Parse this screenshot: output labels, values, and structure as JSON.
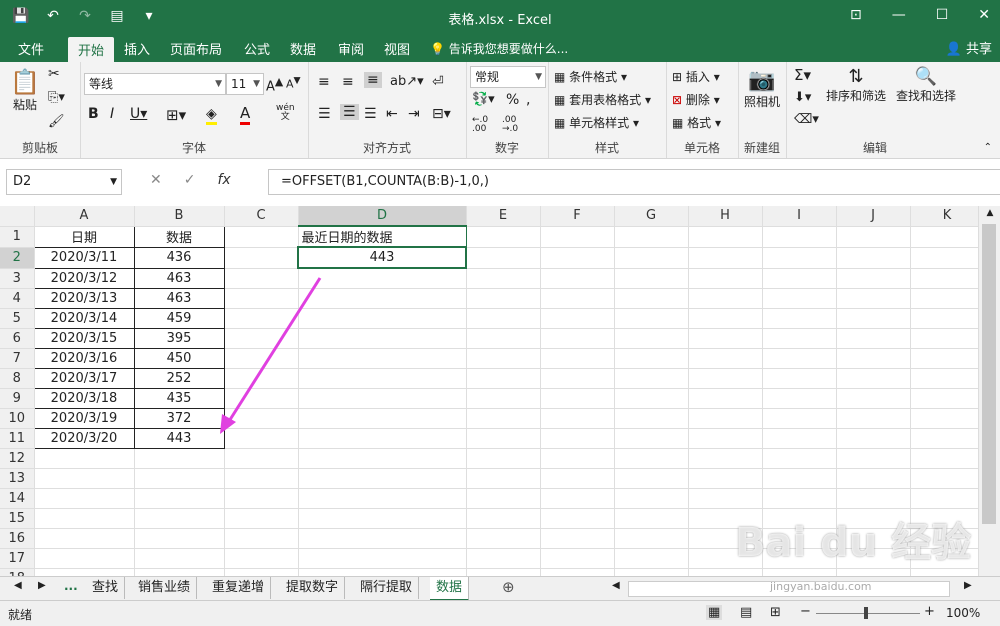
{
  "window": {
    "title": "表格.xlsx - Excel"
  },
  "qat": {
    "save": "💾",
    "undo": "↶",
    "redo": "↷",
    "form": "▤",
    "more": "▾"
  },
  "winctl": {
    "ribbon_opts": "⊡",
    "minimize": "—",
    "maximize": "☐",
    "close": "✕"
  },
  "menu": {
    "tabs": [
      "文件",
      "开始",
      "插入",
      "页面布局",
      "公式",
      "数据",
      "审阅",
      "视图"
    ],
    "tell_me": "告诉我您想要做什么...",
    "share": "共享"
  },
  "ribbon": {
    "clipboard": {
      "paste": "粘贴",
      "group": "剪贴板"
    },
    "font": {
      "font_name": "等线",
      "font_size": "11",
      "group": "字体",
      "wen": "wén"
    },
    "alignment": {
      "group": "对齐方式"
    },
    "number": {
      "format": "常规",
      "group": "数字"
    },
    "styles": {
      "conditional": "条件格式",
      "table": "套用表格格式",
      "cell": "单元格样式",
      "group": "样式"
    },
    "cells": {
      "insert": "插入",
      "delete": "删除",
      "format": "格式",
      "group": "单元格"
    },
    "camera": {
      "label": "照相机",
      "group": "新建组"
    },
    "editing": {
      "sort": "排序和筛选",
      "find": "查找和选择",
      "group": "编辑"
    }
  },
  "formula_bar": {
    "name_box": "D2",
    "cancel": "✕",
    "enter": "✓",
    "fx": "fx",
    "formula": "=OFFSET(B1,COUNTA(B:B)-1,0,)"
  },
  "sheet": {
    "columns": [
      "A",
      "B",
      "C",
      "D",
      "E",
      "F",
      "G",
      "H",
      "I",
      "J",
      "K"
    ],
    "rows": [
      [
        "日期",
        "数据",
        "",
        "最近日期的数据"
      ],
      [
        "2020/3/11",
        "436",
        "",
        "443"
      ],
      [
        "2020/3/12",
        "463",
        "",
        ""
      ],
      [
        "2020/3/13",
        "463",
        "",
        ""
      ],
      [
        "2020/3/14",
        "459",
        "",
        ""
      ],
      [
        "2020/3/15",
        "395",
        "",
        ""
      ],
      [
        "2020/3/16",
        "450",
        "",
        ""
      ],
      [
        "2020/3/17",
        "252",
        "",
        ""
      ],
      [
        "2020/3/18",
        "435",
        "",
        ""
      ],
      [
        "2020/3/19",
        "372",
        "",
        ""
      ],
      [
        "2020/3/20",
        "443",
        "",
        ""
      ],
      [
        "",
        "",
        "",
        ""
      ],
      [
        "",
        "",
        "",
        ""
      ],
      [
        "",
        "",
        "",
        ""
      ],
      [
        "",
        "",
        "",
        ""
      ],
      [
        "",
        "",
        "",
        ""
      ],
      [
        "",
        "",
        "",
        ""
      ],
      [
        "",
        "",
        "",
        ""
      ]
    ]
  },
  "sheet_tabs": {
    "more": "...",
    "tabs": [
      "查找",
      "销售业绩",
      "重复递增",
      "提取数字",
      "隔行提取",
      "数据"
    ],
    "add": "⊕"
  },
  "status": {
    "text": "就绪",
    "zoom": "100%"
  },
  "watermark": {
    "text": "Bai du 经验",
    "url": "jingyan.baidu.com"
  },
  "colors": {
    "accent": "#217346",
    "arrow": "#e040e0"
  }
}
